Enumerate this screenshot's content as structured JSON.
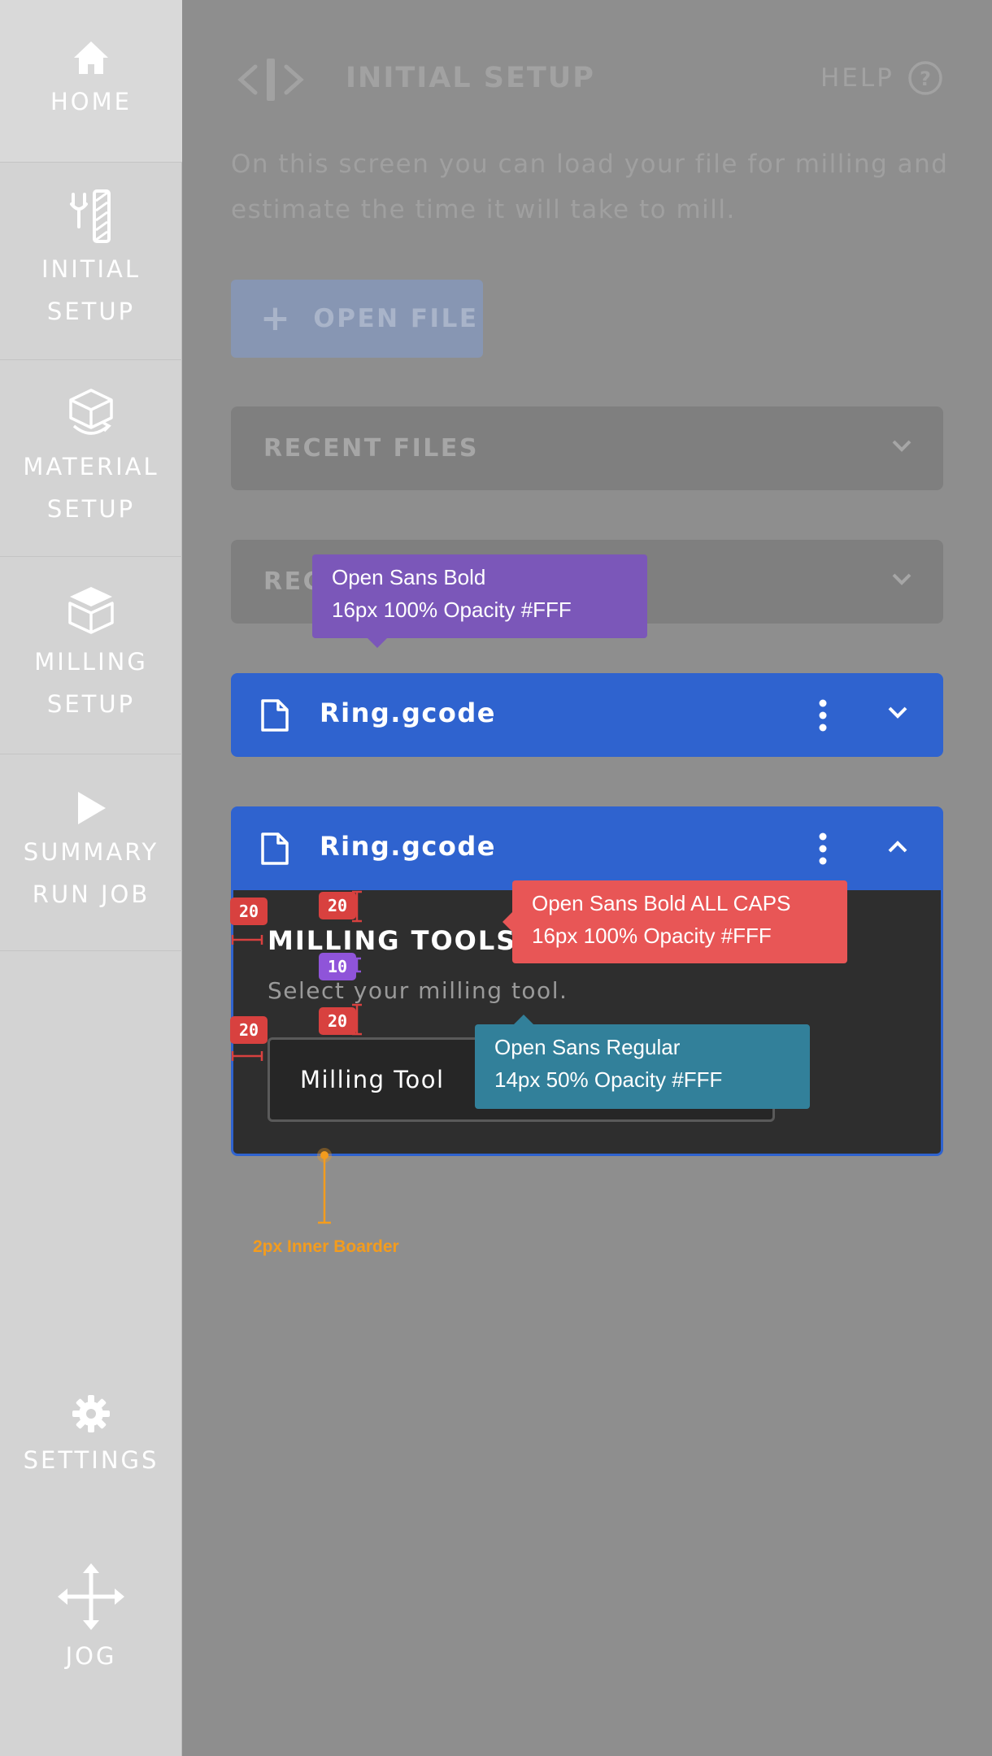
{
  "sidebar": {
    "items": [
      {
        "label": "HOME",
        "icon": "home-icon"
      },
      {
        "label": "INITIAL\nSETUP",
        "icon": "milling-bit-icon"
      },
      {
        "label": "MATERIAL\nSETUP",
        "icon": "material-cube-icon"
      },
      {
        "label": "MILLING\nSETUP",
        "icon": "milling-stack-icon"
      },
      {
        "label": "SUMMARY\nRUN JOB",
        "icon": "play-icon"
      }
    ],
    "bottom_items": [
      {
        "label": "SETTINGS",
        "icon": "gear-icon"
      },
      {
        "label": "JOG",
        "icon": "move-arrows-icon"
      }
    ]
  },
  "header": {
    "title": "INITIAL SETUP",
    "help_label": "HELP",
    "help_icon": "help-circle-icon",
    "header_icon": "arrows-swap-icon"
  },
  "intro": "On this screen you can load your file for milling and estimate the time it will take to mill.",
  "open_file": {
    "label": "OPEN FILE",
    "icon": "plus-icon"
  },
  "accordions": [
    {
      "label": "RECENT FILES",
      "icon": "chevron-down-icon"
    },
    {
      "label": "REC",
      "icon": "chevron-down-icon"
    }
  ],
  "files": [
    {
      "name": "Ring.gcode",
      "icon": "file-icon",
      "state": "collapsed"
    },
    {
      "name": "Ring.gcode",
      "icon": "file-icon",
      "state": "expanded"
    }
  ],
  "panel": {
    "title": "MILLING TOOLS",
    "subtitle": "Select your milling tool.",
    "select_value": "Milling Tool"
  },
  "annotations": {
    "tip_purple_line1": "Open Sans Bold",
    "tip_purple_line2": "16px 100% Opacity #FFF",
    "tip_red_line1": "Open Sans Bold ALL CAPS",
    "tip_red_line2": "16px 100% Opacity #FFF",
    "tip_teal_line1": "Open Sans Regular",
    "tip_teal_line2": "14px 50% Opacity #FFF",
    "badge_20": "20",
    "badge_10": "10",
    "border_note": "2px Inner Boarder"
  },
  "colors": {
    "accent_blue": "#2f63cf",
    "sidebar_bg": "#d3d3d3",
    "overlay_bg": "#8e8e8e",
    "panel_bg": "#2e2e2e",
    "tip_purple": "#7b57b9",
    "tip_red": "#e85656",
    "tip_teal": "#32809a",
    "note_orange": "#f39c1e"
  }
}
